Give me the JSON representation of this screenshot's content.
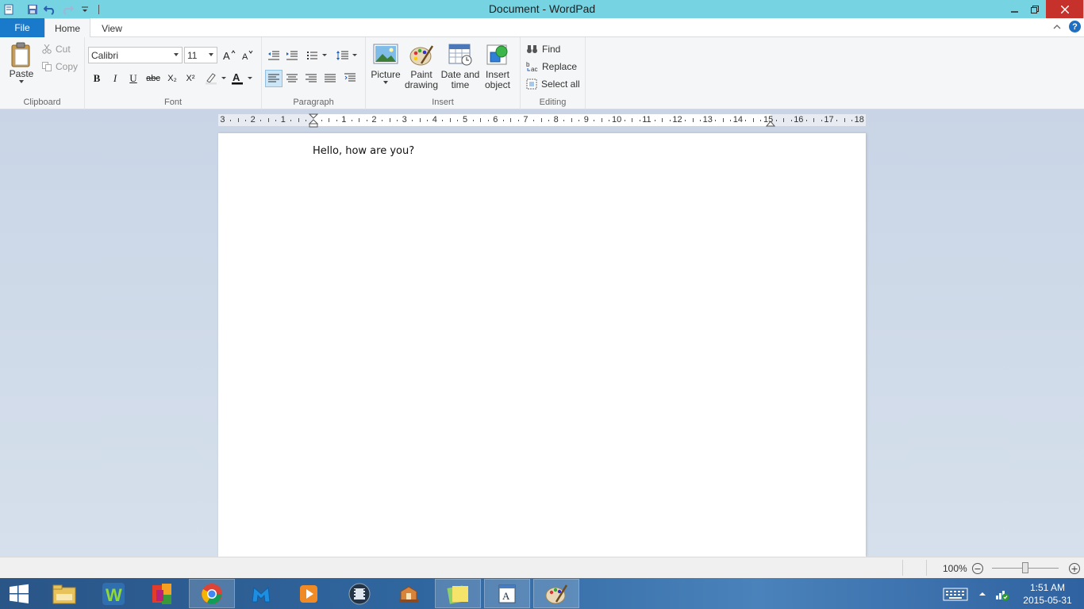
{
  "window": {
    "title": "Document - WordPad",
    "controls": [
      "minimize",
      "restore",
      "close"
    ]
  },
  "quick_access": [
    "save-icon",
    "undo-icon",
    "redo-icon",
    "customize-icon"
  ],
  "tabs": {
    "file": "File",
    "home": "Home",
    "view": "View"
  },
  "ribbon": {
    "clipboard": {
      "label": "Clipboard",
      "paste": "Paste",
      "cut": "Cut",
      "copy": "Copy"
    },
    "font": {
      "label": "Font",
      "family": "Calibri",
      "size": "11",
      "bold": "B",
      "italic": "I",
      "underline": "U",
      "strike": "abc",
      "subscript": "X₂",
      "superscript": "X²"
    },
    "paragraph": {
      "label": "Paragraph",
      "alignment_selected": "left"
    },
    "insert": {
      "label": "Insert",
      "picture": "Picture",
      "paint_drawing_1": "Paint",
      "paint_drawing_2": "drawing",
      "date_time_1": "Date and",
      "date_time_2": "time",
      "insert_object_1": "Insert",
      "insert_object_2": "object"
    },
    "editing": {
      "label": "Editing",
      "find": "Find",
      "replace": "Replace",
      "select_all": "Select all"
    }
  },
  "ruler": {
    "left_numbers": [
      "3",
      "2",
      "1"
    ],
    "right_numbers": [
      "1",
      "2",
      "3",
      "4",
      "5",
      "6",
      "7",
      "8",
      "9",
      "10",
      "11",
      "12",
      "13",
      "14",
      "15",
      "16",
      "17",
      "18"
    ]
  },
  "document": {
    "text": "Hello, how are you?"
  },
  "status": {
    "zoom": "100%",
    "zoom_out": "−",
    "zoom_in": "+"
  },
  "taskbar": {
    "apps": [
      "start-icon",
      "file-explorer-icon",
      "w-app-icon",
      "color-app-icon",
      "chrome-icon",
      "malwarebytes-icon",
      "media-player-icon",
      "video-app-icon",
      "bridge-app-icon",
      "notes-app-icon",
      "wordpad-icon",
      "paint-icon"
    ],
    "time": "1:51 AM",
    "date": "2015-05-31"
  }
}
